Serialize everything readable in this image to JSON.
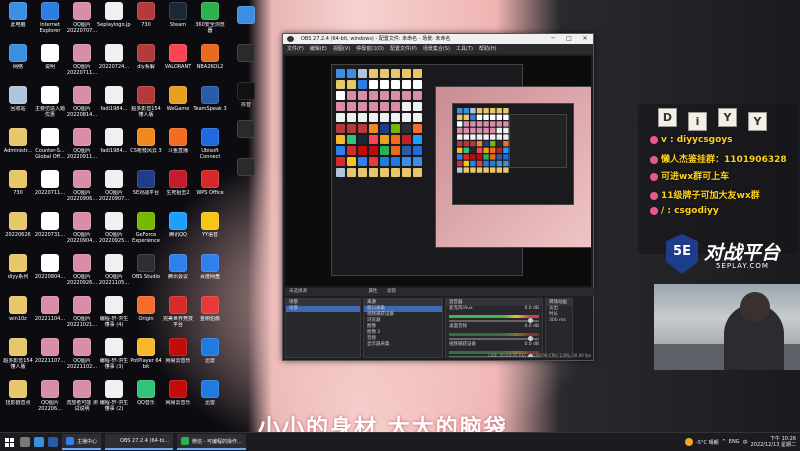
{
  "desktop": {
    "icons": [
      {
        "label": "此电脑",
        "color": "#3c8fe0",
        "col": 0,
        "row": 0
      },
      {
        "label": "网络",
        "color": "#3c8fe0",
        "col": 0,
        "row": 1
      },
      {
        "label": "回收站",
        "color": "#b0c4de",
        "col": 0,
        "row": 2
      },
      {
        "label": "Administr...",
        "color": "#e8c66a",
        "col": 0,
        "row": 3
      },
      {
        "label": "730",
        "color": "#e8c66a",
        "col": 0,
        "row": 4
      },
      {
        "label": "20220626",
        "color": "#e8c66a",
        "col": 0,
        "row": 5
      },
      {
        "label": "diyy系列",
        "color": "#e8c66a",
        "col": 0,
        "row": 6
      },
      {
        "label": "win10z",
        "color": "#e8c66a",
        "col": 0,
        "row": 7
      },
      {
        "label": "超多影音154 懂人版",
        "color": "#e8c66a",
        "col": 0,
        "row": 8
      },
      {
        "label": "扭影戳音点",
        "color": "#e8c66a",
        "col": 0,
        "row": 9
      },
      {
        "label": "Internet Explorer",
        "color": "#2e7de1",
        "col": 1,
        "row": 0
      },
      {
        "label": "说明",
        "color": "#ffffff",
        "col": 1,
        "row": 1
      },
      {
        "label": "主要仿造入题优惠",
        "color": "#ffffff",
        "col": 1,
        "row": 2
      },
      {
        "label": "Counter-S... Global Off...",
        "color": "#ffffff",
        "col": 1,
        "row": 3
      },
      {
        "label": "20220711...",
        "color": "#ffffff",
        "col": 1,
        "row": 4
      },
      {
        "label": "20220731...",
        "color": "#ffffff",
        "col": 1,
        "row": 5
      },
      {
        "label": "20220804...",
        "color": "#ffffff",
        "col": 1,
        "row": 6
      },
      {
        "label": "20221104...",
        "color": "#d98ea8",
        "col": 1,
        "row": 7
      },
      {
        "label": "20221107...",
        "color": "#d98ea8",
        "col": 1,
        "row": 8
      },
      {
        "label": "QQ图片 202206...",
        "color": "#d98ea8",
        "col": 1,
        "row": 9
      },
      {
        "label": "QQ图片 20220707...",
        "color": "#d98ea8",
        "col": 2,
        "row": 0
      },
      {
        "label": "QQ图片 20220711...",
        "color": "#d98ea8",
        "col": 2,
        "row": 1
      },
      {
        "label": "QQ图片 20220814...",
        "color": "#d98ea8",
        "col": 2,
        "row": 2
      },
      {
        "label": "QQ图片 20220911...",
        "color": "#d98ea8",
        "col": 2,
        "row": 3
      },
      {
        "label": "QQ图片 20220906...",
        "color": "#d98ea8",
        "col": 2,
        "row": 4
      },
      {
        "label": "QQ图片 20220904...",
        "color": "#d98ea8",
        "col": 2,
        "row": 5
      },
      {
        "label": "QQ图片 20220926...",
        "color": "#d98ea8",
        "col": 2,
        "row": 6
      },
      {
        "label": "QQ图片 20221021...",
        "color": "#d98ea8",
        "col": 2,
        "row": 7
      },
      {
        "label": "QQ图片 20221102...",
        "color": "#d98ea8",
        "col": 2,
        "row": 8
      },
      {
        "label": "流放者可能 测试说明",
        "color": "#d98ea8",
        "col": 2,
        "row": 9
      },
      {
        "label": "5eplaylogo.jpg",
        "color": "#f0f0f0",
        "col": 3,
        "row": 0
      },
      {
        "label": "20220724...",
        "color": "#f0f0f0",
        "col": 3,
        "row": 1
      },
      {
        "label": "fadi1984...",
        "color": "#f0f0f0",
        "col": 3,
        "row": 2
      },
      {
        "label": "fadi1984...",
        "color": "#f0f0f0",
        "col": 3,
        "row": 3
      },
      {
        "label": "QQ图片 20220907...",
        "color": "#f0f0f0",
        "col": 3,
        "row": 4
      },
      {
        "label": "QQ图片 20220925...",
        "color": "#f0f0f0",
        "col": 3,
        "row": 5
      },
      {
        "label": "QQ图片 20221105...",
        "color": "#f0f0f0",
        "col": 3,
        "row": 6
      },
      {
        "label": "编程-轩-洪生 懂事 (4)",
        "color": "#f0f0f0",
        "col": 3,
        "row": 7
      },
      {
        "label": "编程-轩-洪生 懂事 (3)",
        "color": "#f0f0f0",
        "col": 3,
        "row": 8
      },
      {
        "label": "编程-轩-洪生 懂事 (2)",
        "color": "#f0f0f0",
        "col": 3,
        "row": 9
      },
      {
        "label": "730",
        "color": "#b53b3b",
        "col": 4,
        "row": 0
      },
      {
        "label": "diy系解",
        "color": "#b53b3b",
        "col": 4,
        "row": 1
      },
      {
        "label": "超多影音154 懂人版",
        "color": "#b53b3b",
        "col": 4,
        "row": 2
      },
      {
        "label": "CS枪枝风云 3",
        "color": "#f08a1e",
        "col": 4,
        "row": 3
      },
      {
        "label": "5E对战平台",
        "color": "#1e3c8a",
        "col": 4,
        "row": 4
      },
      {
        "label": "GeForce Experience",
        "color": "#76b900",
        "col": 4,
        "row": 5
      },
      {
        "label": "OBS Studio",
        "color": "#302e31",
        "col": 4,
        "row": 6
      },
      {
        "label": "Origin",
        "color": "#f56c2d",
        "col": 4,
        "row": 7
      },
      {
        "label": "PotPlayer 64 bit",
        "color": "#f5b82d",
        "col": 4,
        "row": 8
      },
      {
        "label": "QQ音乐",
        "color": "#31c27c",
        "col": 4,
        "row": 9
      },
      {
        "label": "Steam",
        "color": "#1b2838",
        "col": 5,
        "row": 0
      },
      {
        "label": "VALORANT",
        "color": "#fa4454",
        "col": 5,
        "row": 1
      },
      {
        "label": "WeGame",
        "color": "#e8a020",
        "col": 5,
        "row": 2
      },
      {
        "label": "斗鱼直播",
        "color": "#f26d21",
        "col": 5,
        "row": 3
      },
      {
        "label": "生死狙击2",
        "color": "#c21d2a",
        "col": 5,
        "row": 4
      },
      {
        "label": "腾讯QQ",
        "color": "#1e9fff",
        "col": 5,
        "row": 5
      },
      {
        "label": "腾讯会议",
        "color": "#2f80ed",
        "col": 5,
        "row": 6
      },
      {
        "label": "完美世界竞技平台",
        "color": "#d52b2b",
        "col": 5,
        "row": 7
      },
      {
        "label": "网易云音乐",
        "color": "#c20c0c",
        "col": 5,
        "row": 8
      },
      {
        "label": "网易云音乐",
        "color": "#c20c0c",
        "col": 5,
        "row": 9
      },
      {
        "label": "360安全浏览器",
        "color": "#2bb24c",
        "col": 6,
        "row": 0
      },
      {
        "label": "NBA2KOL2",
        "color": "#e86a1e",
        "col": 6,
        "row": 1
      },
      {
        "label": "TeamSpeak 3",
        "color": "#2a5aa8",
        "col": 6,
        "row": 2
      },
      {
        "label": "Ubisoft Connect",
        "color": "#1e6ae0",
        "col": 6,
        "row": 3
      },
      {
        "label": "WPS Office",
        "color": "#d42a2a",
        "col": 6,
        "row": 4
      },
      {
        "label": "YY语音",
        "color": "#f5c518",
        "col": 6,
        "row": 5
      },
      {
        "label": "百度网盘",
        "color": "#2f80ed",
        "col": 6,
        "row": 6
      },
      {
        "label": "金刚伯爵",
        "color": "#e83a3a",
        "col": 6,
        "row": 7
      },
      {
        "label": "迅雷",
        "color": "#1e7be0",
        "col": 6,
        "row": 8
      },
      {
        "label": "迅雷",
        "color": "#1e7be0",
        "col": 6,
        "row": 9
      }
    ],
    "strip_icons": [
      {
        "label": "",
        "color": "#3c8fe0"
      },
      {
        "label": "",
        "color": "#2a2a2a"
      },
      {
        "label": "抖音",
        "color": "#111111"
      },
      {
        "label": "",
        "color": "#2a2a2a"
      },
      {
        "label": "",
        "color": "#2a2a2a"
      }
    ],
    "wallpaper_caption": "小小的身材 大大的脑袋"
  },
  "obs": {
    "title": "OBS 27.2.4 (64-bit, windows) - 配置文件: 未命名 - 场景: 未命名",
    "menu": [
      "文件(F)",
      "编辑(E)",
      "视图(V)",
      "停靠窗口(D)",
      "配置文件(P)",
      "场景集合(S)",
      "工具(T)",
      "帮助(H)"
    ],
    "window_controls": {
      "minimize": "─",
      "maximize": "□",
      "close": "✕"
    },
    "scenes_toolbar": "未选择源",
    "scene_buttons": [
      "属性",
      "滤镜"
    ],
    "docks": {
      "scenes": {
        "title": "场景",
        "items": [
          "场景"
        ]
      },
      "sources": {
        "title": "来源",
        "items": [
          "窗口采集",
          "视频捕获设备",
          "浏览器",
          "图像",
          "图像 2",
          "音频",
          "显示器采集"
        ]
      },
      "mixer": {
        "title": "混音器",
        "channels": [
          {
            "name": "麦克风/Aux",
            "db": "0.0 dB"
          },
          {
            "name": "桌面音频",
            "db": "0.0 dB"
          },
          {
            "name": "视频捕获设备",
            "db": "0.0 dB"
          }
        ]
      },
      "transitions": {
        "title": "转场动画",
        "type": "淡出",
        "duration_label": "时长",
        "duration": "300 ms"
      },
      "controls": {
        "title": "控件",
        "buttons": [
          "开始推流",
          "开始录制",
          "启动虚拟摄像机",
          "工作室模式",
          "设置",
          "退出"
        ]
      }
    },
    "status": "LIVE: 00:00:00  REC: 00:00:00  CPU: 2.8%, 30.00 fps"
  },
  "overlay": {
    "letters": [
      "D",
      "i",
      "Y",
      "Y"
    ],
    "lines": [
      {
        "text": "v : diyycsgoys"
      },
      {
        "text": "懒人杰鉴挂群：1101906328"
      },
      {
        "text": "可进wx群可上车"
      },
      {
        "text": "11级牌子可加大友wx群"
      },
      {
        "text": "/  : csgodiyy"
      }
    ],
    "logo_text": "对战平台",
    "logo_mark": "5E",
    "logo_url": "5EPLAY.COM"
  },
  "taskbar": {
    "tasks": [
      {
        "label": "主播中心",
        "color": "#2f80ed"
      },
      {
        "label": "OBS 27.2.4 (64-bi...",
        "color": "#302e31"
      },
      {
        "label": "微信 - 可编程的操作...",
        "color": "#2bb24c"
      }
    ],
    "pinned_colors": [
      "#7a7a7a",
      "#3c8fe0",
      "#2a5aa8"
    ],
    "weather": "-5°C 晴朗",
    "tray_icons": [
      "^",
      "ENG",
      "中"
    ],
    "time": "下午 10:26",
    "date": "2022/12/13 星期二"
  },
  "colors": {
    "accent": "#6aa7ff",
    "overlay_text": "#ffd21a",
    "obs_bg": "#1f1f23"
  }
}
